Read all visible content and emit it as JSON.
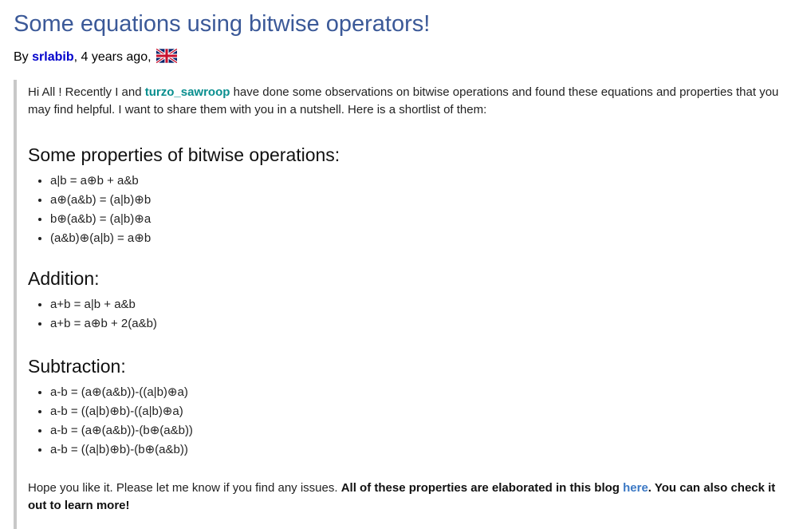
{
  "post": {
    "title": "Some equations using bitwise operators!",
    "byline": {
      "prefix": "By ",
      "author": "srlabib",
      "time": ", 4 years ago, "
    },
    "intro": {
      "part1": "Hi All ! Recently I and ",
      "mention": "turzo_sawroop",
      "part2": " have done some observations on bitwise operations and found these equations and properties that you may find helpful. I want to share them with you in a nutshell. Here is a shortlist of them:"
    },
    "sections": [
      {
        "heading": "Some properties of bitwise operations:",
        "items": [
          "a|b = a⊕b + a&b",
          "a⊕(a&b) = (a|b)⊕b",
          "b⊕(a&b) = (a|b)⊕a",
          "(a&b)⊕(a|b) = a⊕b"
        ]
      },
      {
        "heading": "Addition:",
        "items": [
          "a+b = a|b + a&b",
          "a+b = a⊕b + 2(a&b)"
        ]
      },
      {
        "heading": "Subtraction:",
        "items": [
          "a-b = (a⊕(a&b))-((a|b)⊕a)",
          "a-b = ((a|b)⊕b)-((a|b)⊕a)",
          "a-b = (a⊕(a&b))-(b⊕(a&b))",
          "a-b = ((a|b)⊕b)-(b⊕(a&b))"
        ]
      }
    ],
    "outro": {
      "plain": "Hope you like it. Please let me know if you find any issues. ",
      "bold1": "All of these properties are elaborated in this blog ",
      "link": "here",
      "bold2": ". You can also check it out to learn more!"
    }
  },
  "flag_icon": "uk-flag-icon"
}
